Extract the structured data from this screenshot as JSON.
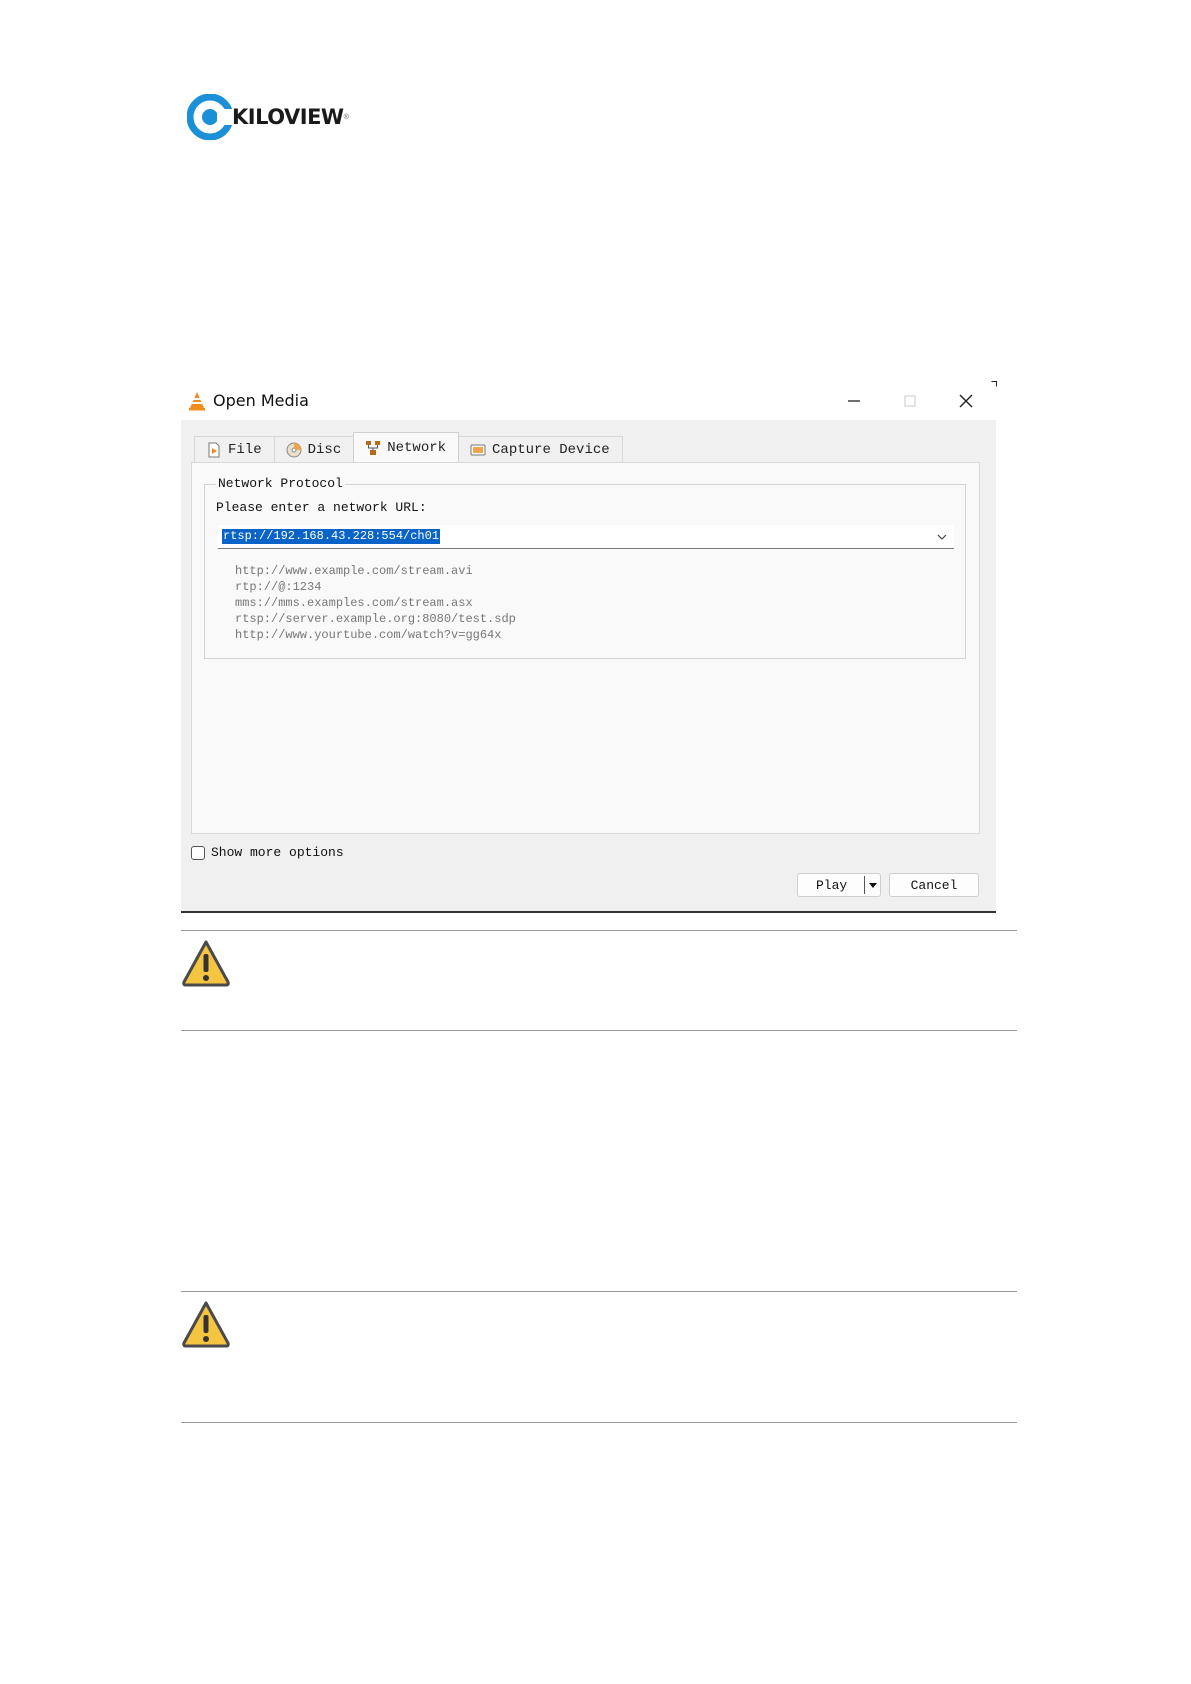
{
  "logo": {
    "text": "KILOVIEW",
    "brand_color": "#1b8fd8"
  },
  "dialog": {
    "title": "Open Media",
    "icons": {
      "app": "vlc-cone-icon",
      "minimize": "minimize-icon",
      "maximize": "maximize-icon",
      "close": "close-icon"
    },
    "tabs": [
      {
        "label": "File",
        "icon": "file-icon",
        "active": false
      },
      {
        "label": "Disc",
        "icon": "disc-icon",
        "active": false
      },
      {
        "label": "Network",
        "icon": "network-icon",
        "active": true
      },
      {
        "label": "Capture Device",
        "icon": "capture-device-icon",
        "active": false
      }
    ],
    "group_title": "Network Protocol",
    "url_label": "Please enter a network URL:",
    "url_value": "rtsp://192.168.43.228:554/ch01",
    "examples": [
      "http://www.example.com/stream.avi",
      "rtp://@:1234",
      "mms://mms.examples.com/stream.asx",
      "rtsp://server.example.org:8080/test.sdp",
      "http://www.yourtube.com/watch?v=gg64x"
    ],
    "show_more_options": "Show more options",
    "play_button": "Play",
    "cancel_button": "Cancel",
    "selection_color": "#0a64c8"
  },
  "notes": [
    {
      "icon": "warning-icon",
      "color": "#f5c542"
    },
    {
      "icon": "warning-icon",
      "color": "#f5c542"
    }
  ]
}
